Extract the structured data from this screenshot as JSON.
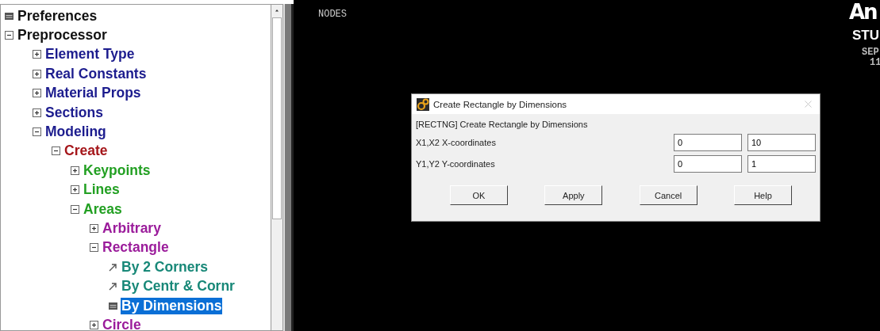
{
  "tree": [
    {
      "label": "Preferences",
      "kind": "dialog",
      "selected": false
    },
    {
      "label": "Preprocessor",
      "kind": "folder",
      "expanded": true,
      "selected": false,
      "children": [
        {
          "label": "Element Type",
          "kind": "folder",
          "expanded": false,
          "selected": false
        },
        {
          "label": "Real Constants",
          "kind": "folder",
          "expanded": false,
          "selected": false
        },
        {
          "label": "Material Props",
          "kind": "folder",
          "expanded": false,
          "selected": false
        },
        {
          "label": "Sections",
          "kind": "folder",
          "expanded": false,
          "selected": false
        },
        {
          "label": "Modeling",
          "kind": "folder",
          "expanded": true,
          "selected": false,
          "children": [
            {
              "label": "Create",
              "kind": "folder",
              "expanded": true,
              "selected": false,
              "children": [
                {
                  "label": "Keypoints",
                  "kind": "folder",
                  "expanded": false,
                  "selected": false
                },
                {
                  "label": "Lines",
                  "kind": "folder",
                  "expanded": false,
                  "selected": false
                },
                {
                  "label": "Areas",
                  "kind": "folder",
                  "expanded": true,
                  "selected": false,
                  "children": [
                    {
                      "label": "Arbitrary",
                      "kind": "folder",
                      "expanded": false,
                      "selected": false
                    },
                    {
                      "label": "Rectangle",
                      "kind": "folder",
                      "expanded": true,
                      "selected": false,
                      "children": [
                        {
                          "label": "By 2 Corners",
                          "kind": "action",
                          "selected": false
                        },
                        {
                          "label": "By Centr & Cornr",
                          "kind": "action",
                          "selected": false
                        },
                        {
                          "label": "By Dimensions",
                          "kind": "dialog",
                          "selected": true
                        }
                      ]
                    },
                    {
                      "label": "Circle",
                      "kind": "folder",
                      "expanded": false,
                      "selected": false
                    }
                  ]
                }
              ]
            }
          ]
        }
      ]
    }
  ],
  "graphics": {
    "plot_label": "NODES",
    "logo": "An",
    "edition": "STU",
    "date": "SEP",
    "time": "11"
  },
  "dialog": {
    "title": "Create Rectangle by Dimensions",
    "heading": "[RECTNG]  Create Rectangle by Dimensions",
    "rows": [
      {
        "label": "X1,X2  X-coordinates",
        "values": [
          "0",
          "10"
        ]
      },
      {
        "label": "Y1,Y2  Y-coordinates",
        "values": [
          "0",
          "1"
        ]
      }
    ],
    "buttons": [
      "OK",
      "Apply",
      "Cancel",
      "Help"
    ]
  }
}
